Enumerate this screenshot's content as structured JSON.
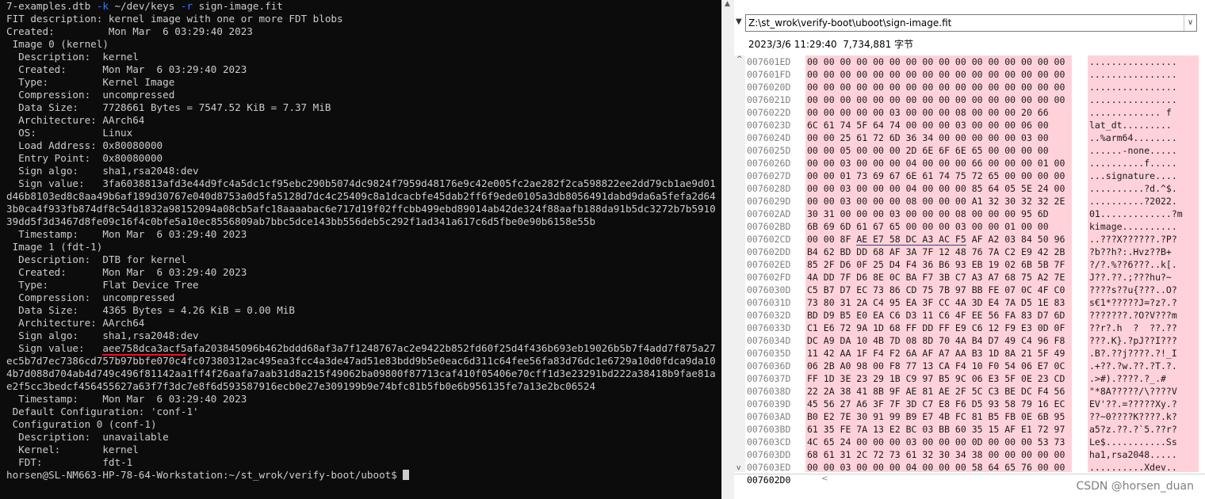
{
  "terminal": {
    "lines": [
      {
        "parts": [
          {
            "t": "7-examples.dtb "
          },
          {
            "t": "-k",
            "c": "flag"
          },
          {
            "t": " ~/dev/keys "
          },
          {
            "t": "-r",
            "c": "flag"
          },
          {
            "t": " sign-image.fit"
          }
        ]
      },
      {
        "parts": [
          {
            "t": "FIT description: kernel image with one or more FDT blobs"
          }
        ]
      },
      {
        "parts": [
          {
            "t": "Created:         Mon Mar  6 03:29:40 2023"
          }
        ]
      },
      {
        "parts": [
          {
            "t": " Image 0 (kernel)"
          }
        ]
      },
      {
        "parts": [
          {
            "t": "  Description:  kernel"
          }
        ]
      },
      {
        "parts": [
          {
            "t": "  Created:      Mon Mar  6 03:29:40 2023"
          }
        ]
      },
      {
        "parts": [
          {
            "t": "  Type:         Kernel Image"
          }
        ]
      },
      {
        "parts": [
          {
            "t": "  Compression:  uncompressed"
          }
        ]
      },
      {
        "parts": [
          {
            "t": "  Data Size:    7728661 Bytes = 7547.52 KiB = 7.37 MiB"
          }
        ]
      },
      {
        "parts": [
          {
            "t": "  Architecture: AArch64"
          }
        ]
      },
      {
        "parts": [
          {
            "t": "  OS:           Linux"
          }
        ]
      },
      {
        "parts": [
          {
            "t": "  Load Address: 0x80080000"
          }
        ]
      },
      {
        "parts": [
          {
            "t": "  Entry Point:  0x80080000"
          }
        ]
      },
      {
        "parts": [
          {
            "t": "  Sign algo:    sha1,rsa2048:dev"
          }
        ]
      },
      {
        "wrap": true,
        "parts": [
          {
            "t": "  Sign value:   3fa6038813afd3e44d9fc4a5dc1cf95ebc290b5074dc9824f7959d48176e9c42e005fc2ae282f2ca598822ee2dd79cb1ae9d01d46b8103ed8c8aa49b6af189d30767e040d8753a0d5fa5128d7dc4c25409c8a1dcacbfe45dab2ff6f9ede0105a3db8056491dabd9da6a5fefa2d643b0ca4f933fb874df8c54d1832a98152094a08cb5afc18aaaabac6e717d19f02ffcbb499ebd89014ab42de324f88aafb188da91b5dc3272b7b591039dd5f3d3467d8fe09c16f4c0bfe5a10ec8556809ab7bbc5dce143bb556deb5c292f1ad341a617c6d5fbe0e90b6158e55b"
          }
        ]
      },
      {
        "parts": [
          {
            "t": "  Timestamp:    Mon Mar  6 03:29:40 2023"
          }
        ]
      },
      {
        "parts": [
          {
            "t": " Image 1 (fdt-1)"
          }
        ]
      },
      {
        "parts": [
          {
            "t": "  Description:  DTB for kernel"
          }
        ]
      },
      {
        "parts": [
          {
            "t": "  Created:      Mon Mar  6 03:29:40 2023"
          }
        ]
      },
      {
        "parts": [
          {
            "t": "  Type:         Flat Device Tree"
          }
        ]
      },
      {
        "parts": [
          {
            "t": "  Compression:  uncompressed"
          }
        ]
      },
      {
        "parts": [
          {
            "t": "  Data Size:    4365 Bytes = 4.26 KiB = 0.00 MiB"
          }
        ]
      },
      {
        "parts": [
          {
            "t": "  Architecture: AArch64"
          }
        ]
      },
      {
        "parts": [
          {
            "t": "  Sign algo:    sha1,rsa2048:dev"
          }
        ]
      },
      {
        "wrap": true,
        "parts": [
          {
            "t": "  Sign value:   "
          },
          {
            "t": "aee758dca3acf5",
            "c": "red-ul"
          },
          {
            "t": "afa203845096b462bddd68af3a7f1248767ac2e9422b852fd60f25d4f436b693eb19026b5b7f4add7f875a27ec5b7d7ec7386cd757b97bbfe070c4fc07380312ac495ea3fcc4a3de47ad51e83bdd9b5e0eac6d311c64fee56fa83d76dc1e6729a10d0fdca9da104b7d088d704ab4d749c496f81142aa1ff4f26aafa7aab31d8a215f49062ba09800f87713caf410f05406e70cff1d3e23291bd222a38418b9fae81ae2f5cc3bedcf456455627a63f7f3dc7e8f6d593587916ecb0e27e309199b9e74bfc81b5fb0e6b956135fe7a13e2bc06524"
          }
        ]
      },
      {
        "parts": [
          {
            "t": "  Timestamp:    Mon Mar  6 03:29:40 2023"
          }
        ]
      },
      {
        "parts": [
          {
            "t": " Default Configuration: 'conf-1'"
          }
        ]
      },
      {
        "parts": [
          {
            "t": " Configuration 0 (conf-1)"
          }
        ]
      },
      {
        "parts": [
          {
            "t": "  Description:  unavailable"
          }
        ]
      },
      {
        "parts": [
          {
            "t": "  Kernel:       kernel"
          }
        ]
      },
      {
        "parts": [
          {
            "t": "  FDT:          fdt-1"
          }
        ]
      },
      {
        "parts": [
          {
            "t": "horsen@SL-NM663-HP-78-64-Workstation:~/st_wrok/verify-boot/uboot$ "
          }
        ],
        "cursor": true
      }
    ]
  },
  "hex": {
    "path": "Z:\\st_wrok\\verify-boot\\uboot\\sign-image.fit",
    "info": "2023/3/6 11:29:40  7,734,881 字节",
    "status_address": "007602D0",
    "rows": [
      {
        "addr": "007601ED",
        "bytes": "00 00 00 00 00 00 00 00 00 00 00 00 00 00 00 00",
        "ascii": "................"
      },
      {
        "addr": "007601FD",
        "bytes": "00 00 00 00 00 00 00 00 00 00 00 00 00 00 00 00",
        "ascii": "................"
      },
      {
        "addr": "0076020D",
        "bytes": "00 00 00 00 00 00 00 00 00 00 00 00 00 00 00 00",
        "ascii": "................"
      },
      {
        "addr": "0076021D",
        "bytes": "00 00 00 00 00 00 00 00 00 00 00 00 00 00 00 00",
        "ascii": "................"
      },
      {
        "addr": "0076022D",
        "bytes": "00 00 00 00 00 03 00 00 00 08 00 00 00 20 66",
        "ascii": "............. f"
      },
      {
        "addr": "0076023D",
        "bytes": "6C 61 74 5F 64 74 00 00 00 03 00 00 00 06 00",
        "ascii": "lat_dt........."
      },
      {
        "addr": "0076024D",
        "bytes": "00 00 25 61 72 6D 36 34 00 00 00 00 00 03 00",
        "ascii": "..%arm64........"
      },
      {
        "addr": "0076025D",
        "bytes": "00 00 05 00 00 00 2D 6E 6F 6E 65 00 00 00 00",
        "ascii": "......-none....."
      },
      {
        "addr": "0076026D",
        "bytes": "00 00 03 00 00 00 04 00 00 00 66 00 00 00 01 00",
        "ascii": "..........f....."
      },
      {
        "addr": "0076027D",
        "bytes": "00 00 01 73 69 67 6E 61 74 75 72 65 00 00 00 00",
        "ascii": "...signature...."
      },
      {
        "addr": "0076028D",
        "bytes": "00 00 03 00 00 00 04 00 00 00 85 64 05 5E 24 00",
        "ascii": "..........?d.^$."
      },
      {
        "addr": "0076029D",
        "bytes": "00 00 03 00 00 00 08 00 00 00 A1 32 30 32 32 2E",
        "ascii": "..........?2022."
      },
      {
        "addr": "007602AD",
        "bytes": "30 31 00 00 00 03 00 00 00 08 00 00 00 95 6D",
        "ascii": "01.............?m"
      },
      {
        "addr": "007602BD",
        "bytes": "6B 69 6D 61 67 65 00 00 00 03 00 00 01 00 00",
        "ascii": "kimage.........."
      },
      {
        "addr": "007602CD",
        "bytes": "00 00 8F AE E7 58 DC A3 AC F5 AF A2 03 84 50 96",
        "ascii": "..???X??????.?P?",
        "ul": true
      },
      {
        "addr": "007602DD",
        "bytes": "B4 62 BD DD 68 AF 3A 7F 12 48 76 7A C2 E9 42 2B",
        "ascii": "?b??h?:.Hvz??B+"
      },
      {
        "addr": "007602ED",
        "bytes": "85 2F D6 0F 25 D4 F4 36 B6 93 EB 19 02 6B 5B 7F",
        "ascii": "?/?.%??6???..k[."
      },
      {
        "addr": "007602FD",
        "bytes": "4A DD 7F D6 8E 0C BA F7 3B C7 A3 A7 68 75 A2 7E",
        "ascii": "J??.??.;???hu?~"
      },
      {
        "addr": "0076030D",
        "bytes": "C5 B7 D7 EC 73 86 CD 75 7B 97 BB FE 07 0C 4F C0",
        "ascii": "????s??u{???..O?"
      },
      {
        "addr": "0076031D",
        "bytes": "73 80 31 2A C4 95 EA 3F CC 4A 3D E4 7A D5 1E 83",
        "ascii": "s€1*?????J=?z?.?"
      },
      {
        "addr": "0076032D",
        "bytes": "BD D9 B5 E0 EA C6 D3 11 C6 4F EE 56 FA 83 D7 6D",
        "ascii": "???????.?O?V???m"
      },
      {
        "addr": "0076033D",
        "bytes": "C1 E6 72 9A 1D 68 FF DD FF E9 C6 12 F9 E3 0D 0F",
        "ascii": "??r?.h  ?  ??.??"
      },
      {
        "addr": "0076034D",
        "bytes": "DC A9 DA 10 4B 7D 08 8D 70 4A B4 D7 49 C4 96 F8",
        "ascii": "???.K}.?pJ??I???"
      },
      {
        "addr": "0076035D",
        "bytes": "11 42 AA 1F F4 F2 6A AF A7 AA B3 1D 8A 21 5F 49",
        "ascii": ".B?.??j????.?!_I"
      },
      {
        "addr": "0076036D",
        "bytes": "06 2B A0 98 00 F8 77 13 CA F4 10 F0 54 06 E7 0C",
        "ascii": ".+??.?w.??.?T.?."
      },
      {
        "addr": "0076037D",
        "bytes": "FF 1D 3E 23 29 1B C9 97 B5 9C 06 E3 5F 0E 23 CD",
        "ascii": ".>#).????.?_.#"
      },
      {
        "addr": "0076038D",
        "bytes": "22 2A 38 41 8B 9F AE 81 AE 2F 5C C3 BE DC F4 56",
        "ascii": "\"*8A?????/\\????V"
      },
      {
        "addr": "0076039D",
        "bytes": "45 56 27 A6 3F 7F 3D C7 E8 F6 D5 93 58 79 16 EC",
        "ascii": "EV'??.=?????Xy.?"
      },
      {
        "addr": "007603AD",
        "bytes": "B0 E2 7E 30 91 99 B9 E7 4B FC 81 B5 FB 0E 6B 95",
        "ascii": "??~0????K????.k?"
      },
      {
        "addr": "007603BD",
        "bytes": "61 35 FE 7A 13 E2 BC 03 BB 60 35 15 AF E1 72 97",
        "ascii": "a5?z.??.?`5.??r?"
      },
      {
        "addr": "007603CD",
        "bytes": "4C 65 24 00 00 00 03 00 00 00 0D 00 00 00 53 73",
        "ascii": "Le$...........Ss"
      },
      {
        "addr": "007603DD",
        "bytes": "68 61 31 2C 72 73 61 32 30 34 38 00 00 00 00 00",
        "ascii": "ha1,rsa2048....."
      },
      {
        "addr": "007603ED",
        "bytes": "00 00 03 00 00 00 04 00 00 00 58 64 65 76 00 00",
        "ascii": "..........Xdev.."
      }
    ]
  },
  "watermark": "CSDN @horsen_duan"
}
